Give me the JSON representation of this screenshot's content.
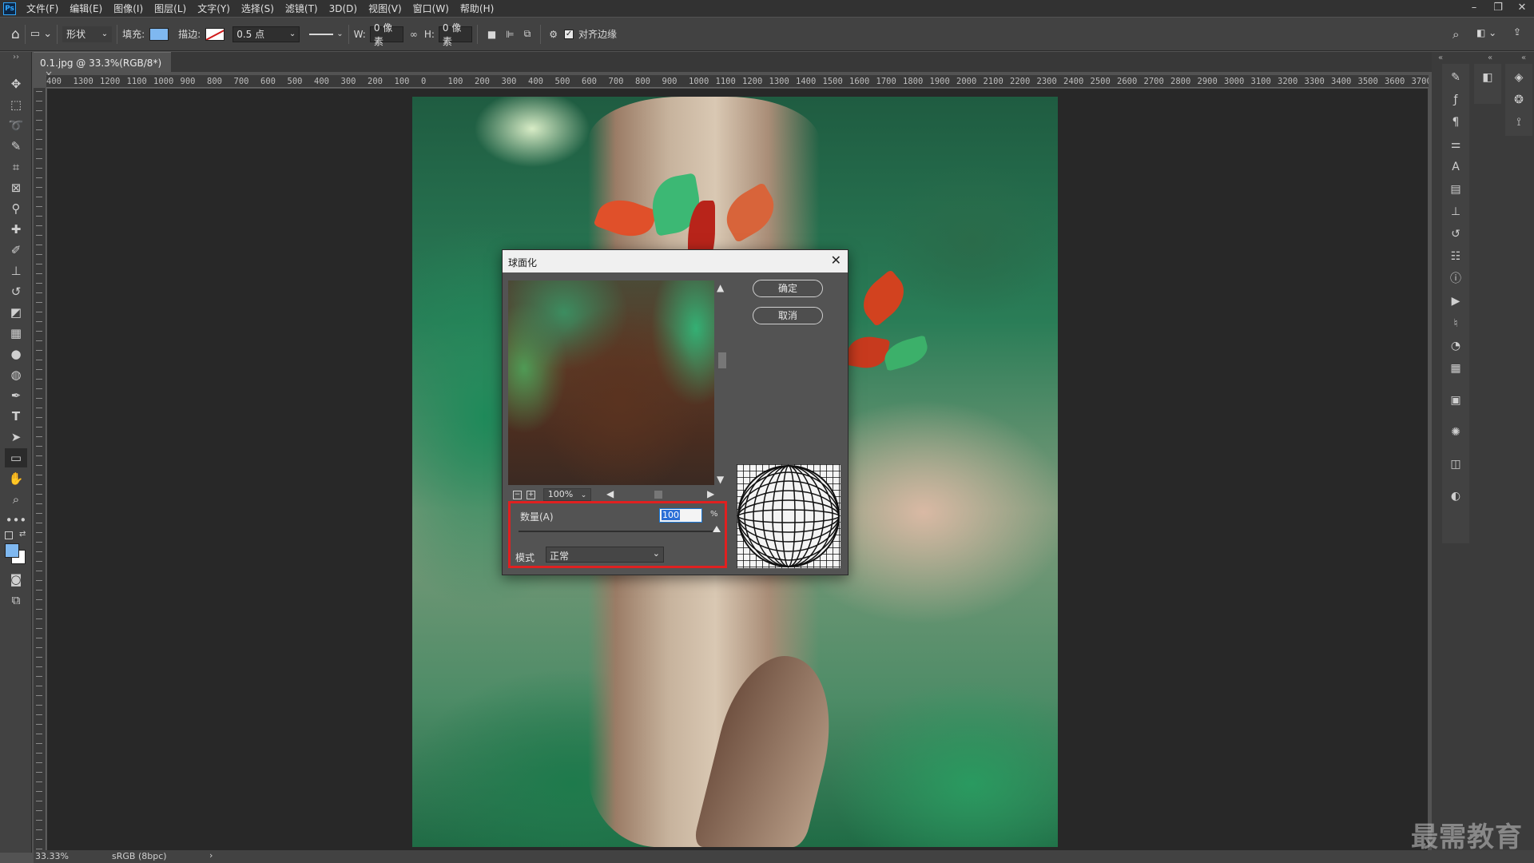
{
  "menubar": {
    "app_icon": "Ps",
    "items": [
      "文件(F)",
      "编辑(E)",
      "图像(I)",
      "图层(L)",
      "文字(Y)",
      "选择(S)",
      "滤镜(T)",
      "3D(D)",
      "视图(V)",
      "窗口(W)",
      "帮助(H)"
    ],
    "window_controls": [
      "minimize-icon",
      "restore-icon",
      "close-icon"
    ]
  },
  "options": {
    "mode": "形状",
    "fill_label": "填充:",
    "fill_color": "#7fb8f0",
    "stroke_label": "描边:",
    "stroke_width": "0.5 点",
    "w_label": "W:",
    "w_value": "0 像素",
    "h_label": "H:",
    "h_value": "0 像素",
    "align_edges_label": "对齐边缘",
    "align_edges_checked": true
  },
  "document": {
    "tab_title": "0.1.jpg @ 33.3%(RGB/8*)",
    "tab_close": "×"
  },
  "ruler": {
    "h_ticks": [
      "400",
      "1300",
      "1200",
      "1100",
      "1000",
      "900",
      "800",
      "700",
      "600",
      "500",
      "400",
      "300",
      "200",
      "100",
      "0",
      "100",
      "200",
      "300",
      "400",
      "500",
      "600",
      "700",
      "800",
      "900",
      "1000",
      "1100",
      "1200",
      "1300",
      "1400",
      "1500",
      "1600",
      "1700",
      "1800",
      "1900",
      "2000",
      "2100",
      "2200",
      "2300",
      "2400",
      "2500",
      "2600",
      "2700",
      "2800",
      "2900",
      "3000",
      "3100",
      "3200",
      "3300",
      "3400",
      "3500",
      "3600",
      "3700"
    ]
  },
  "status": {
    "zoom": "33.33%",
    "color_profile": "sRGB (8bpc)",
    "arrow": "›"
  },
  "dialog": {
    "title": "球面化",
    "ok_label": "确定",
    "cancel_label": "取消",
    "preview_zoom": "100%",
    "amount_label": "数量(A)",
    "amount_value": "100",
    "amount_unit": "%",
    "amount_fraction": 1.0,
    "mode_label": "模式",
    "mode_value": "正常"
  },
  "watermark": "最需教育",
  "colors": {
    "foreground": "#7fb8f0",
    "background": "#ffffff",
    "highlight_box": "#e02020"
  }
}
